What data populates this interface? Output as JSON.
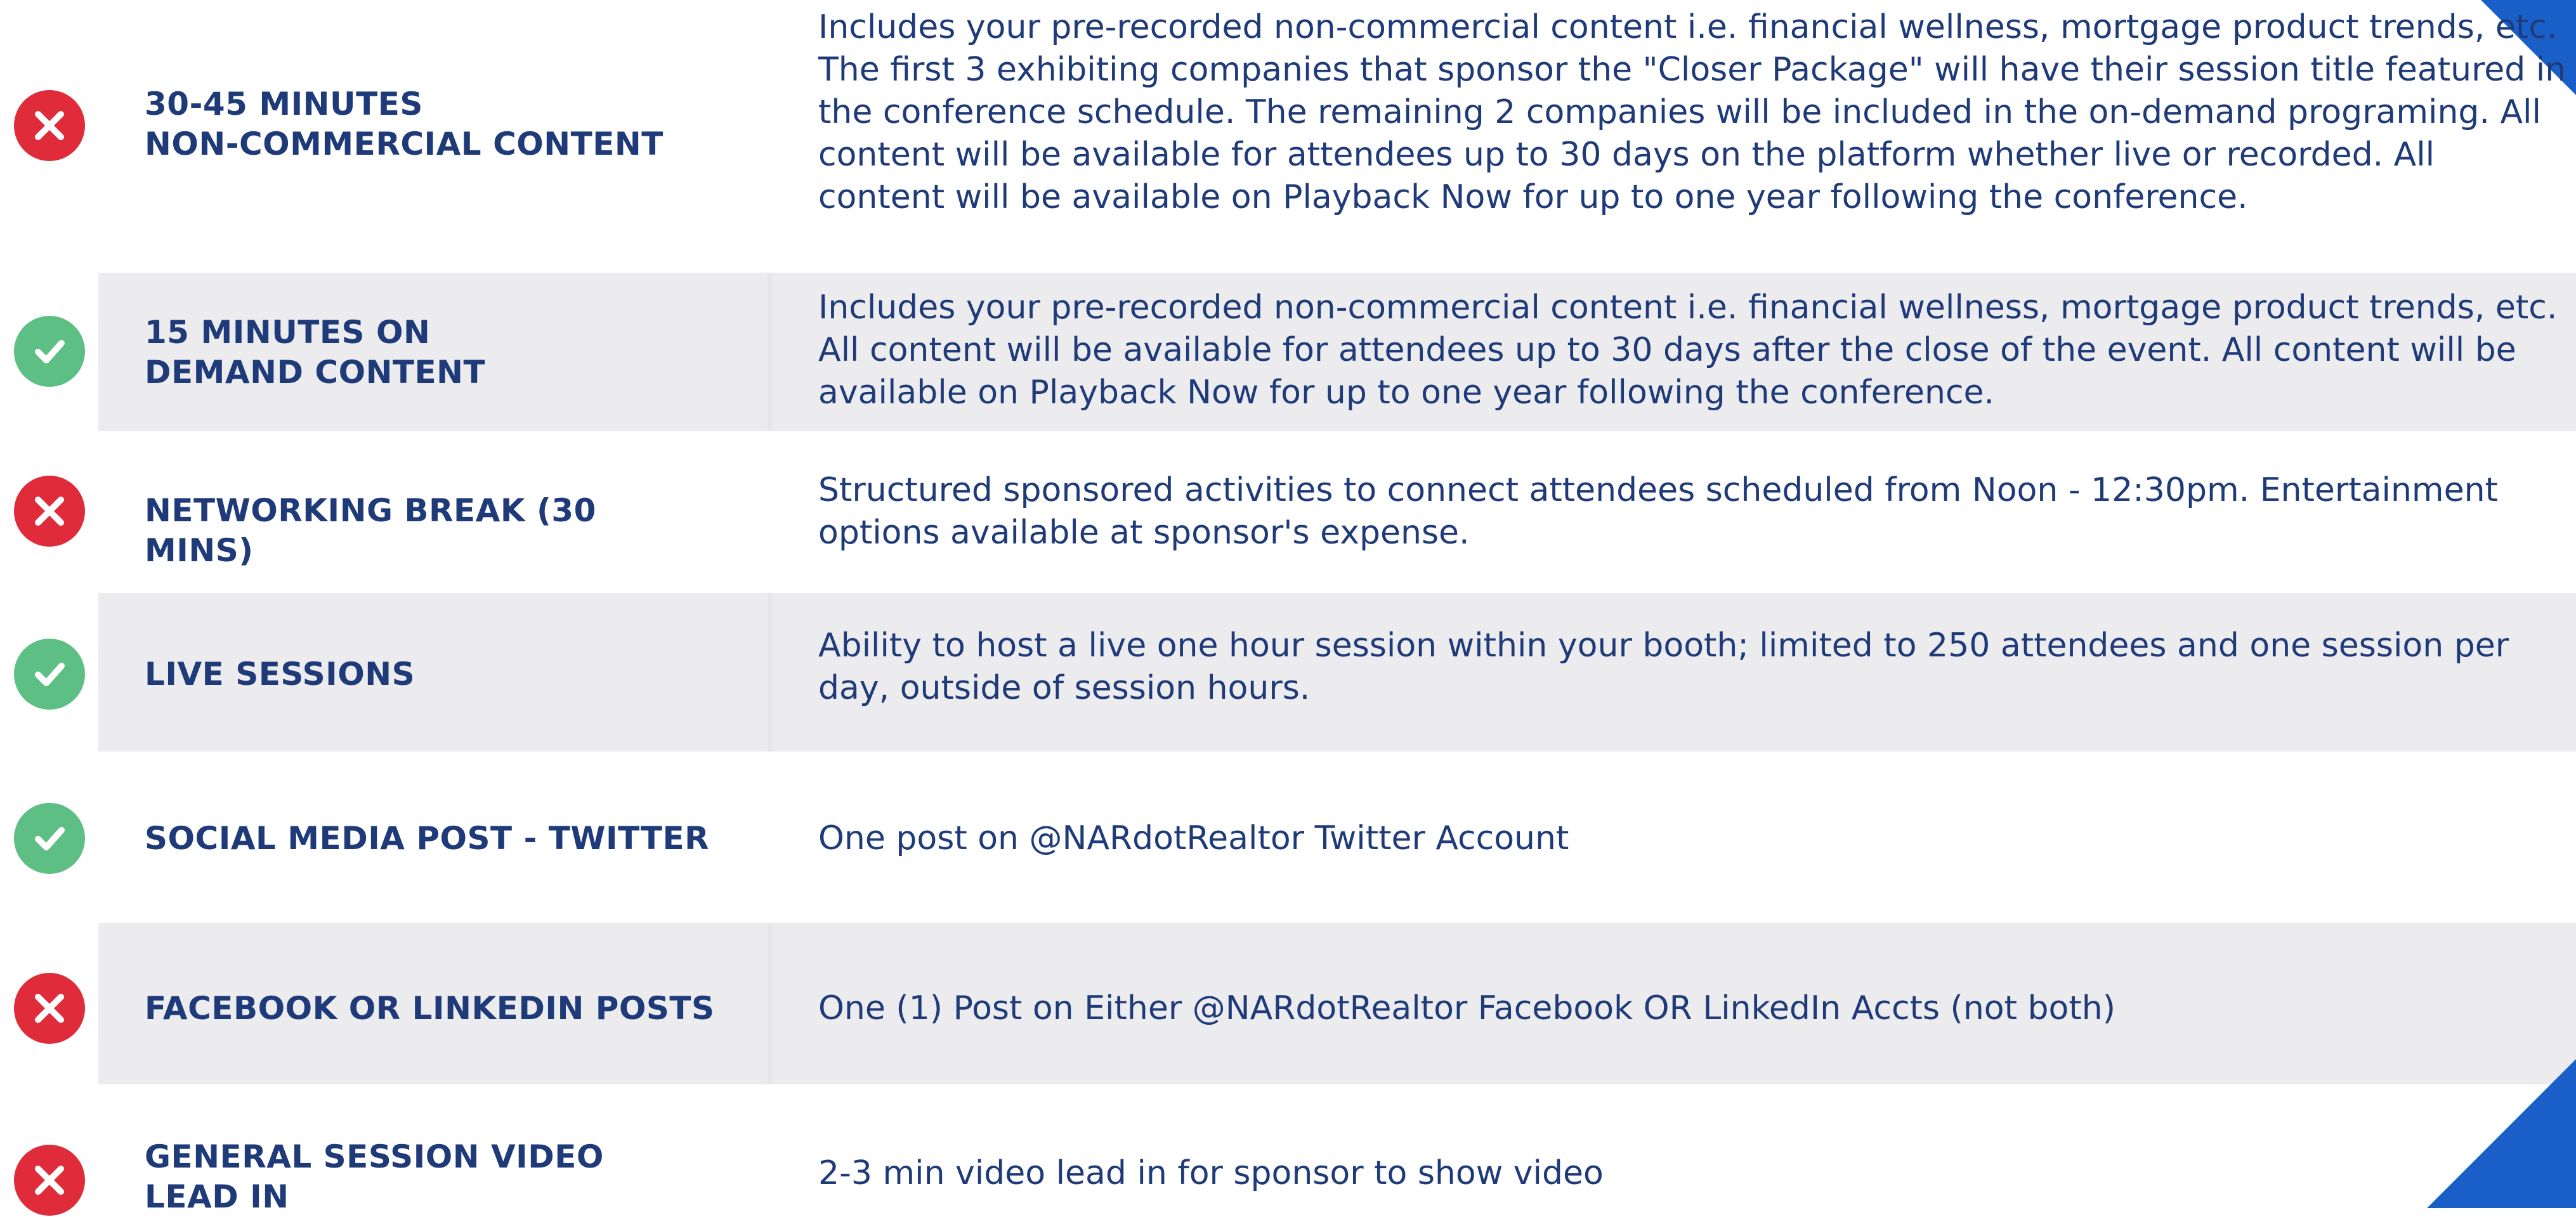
{
  "accent_color": "#1a5fc8",
  "included_color": "#5dbf84",
  "not_included_color": "#e02b3a",
  "features": [
    {
      "status": "not-included",
      "icon": "x-icon",
      "label": "30-45 MINUTES\nNON-COMMERCIAL CONTENT",
      "description": "Includes your pre-recorded non-commercial content i.e. financial wellness, mortgage product trends, etc. The first 3 exhibiting companies that sponsor the \"Closer Package\" will have their session title featured in the conference schedule. The remaining 2 companies will be included in the on-demand programing. All content will be available for attendees up to 30 days on the platform whether live or recorded. All content will be available on Playback Now for up to one year following the conference."
    },
    {
      "status": "included",
      "icon": "check-icon",
      "label": "15 MINUTES ON\nDEMAND CONTENT",
      "description": "Includes your pre-recorded non-commercial content i.e. financial wellness, mortgage product trends, etc. All content will be available for attendees up to 30 days after the close of the event. All content will be available on Playback Now for up to one year following the conference."
    },
    {
      "status": "not-included",
      "icon": "x-icon",
      "label": "NETWORKING BREAK (30 MINS)",
      "description": "Structured sponsored activities to connect attendees scheduled from Noon - 12:30pm. Entertainment options available at sponsor's expense."
    },
    {
      "status": "included",
      "icon": "check-icon",
      "label": "LIVE SESSIONS",
      "description": "Ability to host a live one hour session within your booth; limited to 250 attendees and one session per day, outside of session hours."
    },
    {
      "status": "included",
      "icon": "check-icon",
      "label": "SOCIAL MEDIA POST - TWITTER",
      "description": "One post on @NARdotRealtor Twitter Account"
    },
    {
      "status": "not-included",
      "icon": "x-icon",
      "label": "FACEBOOK OR LINKEDIN POSTS",
      "description": "One (1) Post on Either @NARdotRealtor Facebook OR LinkedIn Accts (not both)"
    },
    {
      "status": "not-included",
      "icon": "x-icon",
      "label": "GENERAL SESSION VIDEO\nLEAD IN",
      "description": "2-3 min video lead in for sponsor to show video"
    }
  ]
}
